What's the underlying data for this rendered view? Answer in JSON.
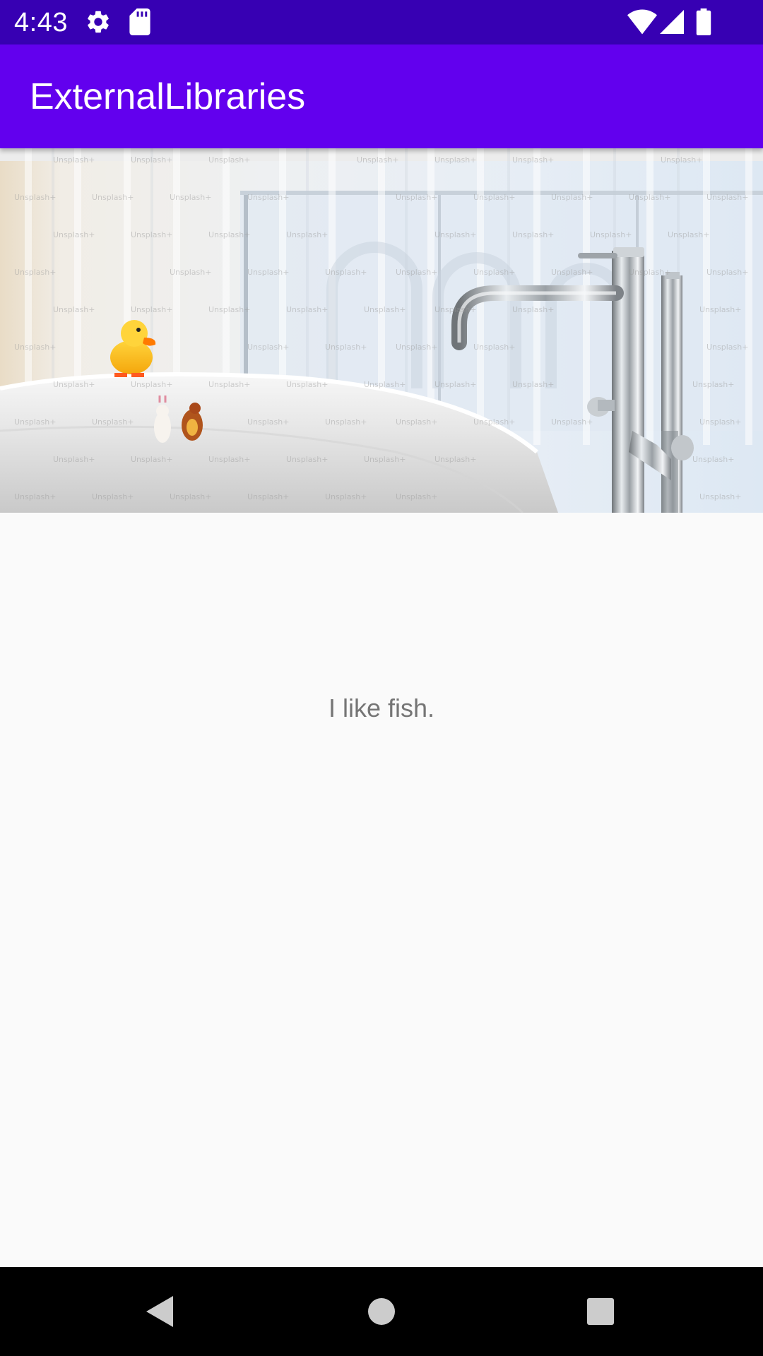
{
  "status_bar": {
    "time": "4:43",
    "icons": [
      "gear-icon",
      "sd-card-icon",
      "wifi-icon",
      "cell-signal-icon",
      "battery-icon"
    ]
  },
  "app_bar": {
    "title": "ExternalLibraries",
    "color": "#6200ee",
    "status_color": "#3700b3"
  },
  "main": {
    "image_description": "bathroom-photo",
    "watermark": "Unsplash+",
    "text": "I like fish."
  },
  "nav_bar": {
    "icons": [
      "back-icon",
      "home-icon",
      "recents-icon"
    ]
  }
}
